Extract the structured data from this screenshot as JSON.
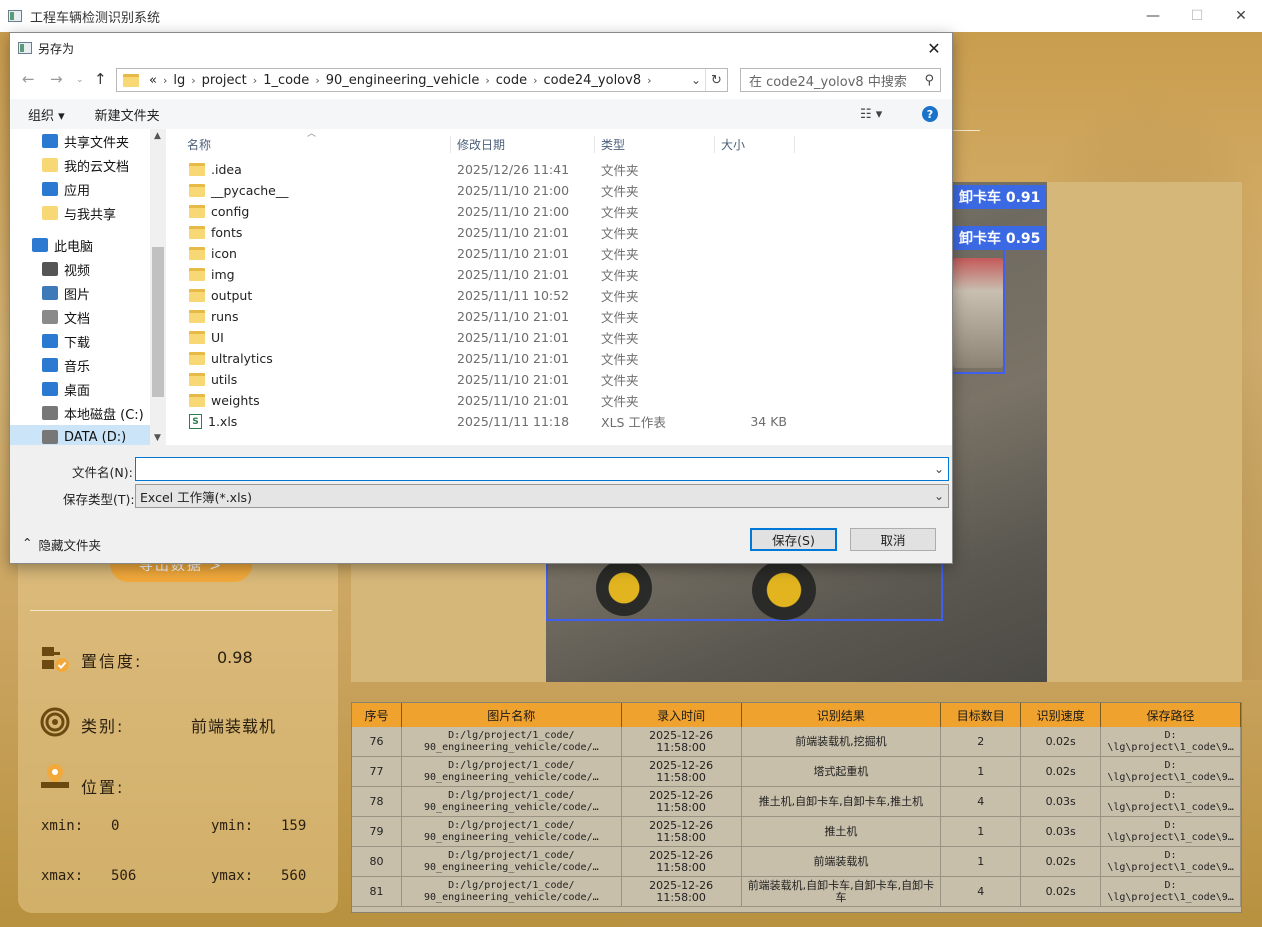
{
  "app": {
    "title": "工程车辆检测识别系统",
    "minimize": "—",
    "maximize": "☐",
    "close": "✕"
  },
  "left_panel": {
    "export_label": "导出数据 >",
    "confidence_label": "置信度:",
    "confidence_value": "0.98",
    "class_label": "类别:",
    "class_value": "前端装载机",
    "position_label": "位置:",
    "xmin_label": "xmin:",
    "xmin_value": "0",
    "ymin_label": "ymin:",
    "ymin_value": "159",
    "xmax_label": "xmax:",
    "xmax_value": "506",
    "ymax_label": "ymax:",
    "ymax_value": "560"
  },
  "detections": {
    "label1": "卸卡车 0.91",
    "label2": "卸卡车 0.95"
  },
  "table": {
    "headers": [
      "序号",
      "图片名称",
      "录入时间",
      "识别结果",
      "目标数目",
      "识别速度",
      "保存路径"
    ],
    "rows": [
      [
        "76",
        "D:/lg/project/1_code/\n90_engineering_vehicle/code/…",
        "2025-12-26\n11:58:00",
        "前端装载机,挖掘机",
        "2",
        "0.02s",
        "D:\n\\lg\\project\\1_code\\9…"
      ],
      [
        "77",
        "D:/lg/project/1_code/\n90_engineering_vehicle/code/…",
        "2025-12-26\n11:58:00",
        "塔式起重机",
        "1",
        "0.02s",
        "D:\n\\lg\\project\\1_code\\9…"
      ],
      [
        "78",
        "D:/lg/project/1_code/\n90_engineering_vehicle/code/…",
        "2025-12-26\n11:58:00",
        "推土机,自卸卡车,自卸卡车,推土机",
        "4",
        "0.03s",
        "D:\n\\lg\\project\\1_code\\9…"
      ],
      [
        "79",
        "D:/lg/project/1_code/\n90_engineering_vehicle/code/…",
        "2025-12-26\n11:58:00",
        "推土机",
        "1",
        "0.03s",
        "D:\n\\lg\\project\\1_code\\9…"
      ],
      [
        "80",
        "D:/lg/project/1_code/\n90_engineering_vehicle/code/…",
        "2025-12-26\n11:58:00",
        "前端装载机",
        "1",
        "0.02s",
        "D:\n\\lg\\project\\1_code\\9…"
      ],
      [
        "81",
        "D:/lg/project/1_code/\n90_engineering_vehicle/code/…",
        "2025-12-26\n11:58:00",
        "前端装载机,自卸卡车,自卸卡车,自卸卡车",
        "4",
        "0.02s",
        "D:\n\\lg\\project\\1_code\\9…"
      ]
    ]
  },
  "dialog": {
    "title": "另存为",
    "breadcrumb": [
      "«",
      "lg",
      "project",
      "1_code",
      "90_engineering_vehicle",
      "code",
      "code24_yolov8"
    ],
    "search_placeholder": "在 code24_yolov8 中搜索",
    "organize": "组织 ▾",
    "new_folder": "新建文件夹",
    "nav_items": [
      {
        "label": "共享文件夹",
        "icon": "share-icon"
      },
      {
        "label": "我的云文档",
        "icon": "folder-icon"
      },
      {
        "label": "应用",
        "icon": "apps-icon"
      },
      {
        "label": "与我共享",
        "icon": "folder-icon"
      },
      {
        "label": "此电脑",
        "icon": "computer-icon"
      },
      {
        "label": "视频",
        "icon": "video-icon"
      },
      {
        "label": "图片",
        "icon": "picture-icon"
      },
      {
        "label": "文档",
        "icon": "document-icon"
      },
      {
        "label": "下载",
        "icon": "download-icon"
      },
      {
        "label": "音乐",
        "icon": "music-icon"
      },
      {
        "label": "桌面",
        "icon": "desktop-icon"
      },
      {
        "label": "本地磁盘 (C:)",
        "icon": "drive-icon"
      },
      {
        "label": "DATA (D:)",
        "icon": "drive-icon"
      }
    ],
    "columns": [
      "名称",
      "修改日期",
      "类型",
      "大小"
    ],
    "files": [
      {
        "name": ".idea",
        "date": "2025/12/26 11:41",
        "type": "文件夹",
        "size": "",
        "kind": "folder"
      },
      {
        "name": "__pycache__",
        "date": "2025/11/10 21:00",
        "type": "文件夹",
        "size": "",
        "kind": "folder"
      },
      {
        "name": "config",
        "date": "2025/11/10 21:00",
        "type": "文件夹",
        "size": "",
        "kind": "folder"
      },
      {
        "name": "fonts",
        "date": "2025/11/10 21:01",
        "type": "文件夹",
        "size": "",
        "kind": "folder"
      },
      {
        "name": "icon",
        "date": "2025/11/10 21:01",
        "type": "文件夹",
        "size": "",
        "kind": "folder"
      },
      {
        "name": "img",
        "date": "2025/11/10 21:01",
        "type": "文件夹",
        "size": "",
        "kind": "folder"
      },
      {
        "name": "output",
        "date": "2025/11/11 10:52",
        "type": "文件夹",
        "size": "",
        "kind": "folder"
      },
      {
        "name": "runs",
        "date": "2025/11/10 21:01",
        "type": "文件夹",
        "size": "",
        "kind": "folder"
      },
      {
        "name": "UI",
        "date": "2025/11/10 21:01",
        "type": "文件夹",
        "size": "",
        "kind": "folder"
      },
      {
        "name": "ultralytics",
        "date": "2025/11/10 21:01",
        "type": "文件夹",
        "size": "",
        "kind": "folder"
      },
      {
        "name": "utils",
        "date": "2025/11/10 21:01",
        "type": "文件夹",
        "size": "",
        "kind": "folder"
      },
      {
        "name": "weights",
        "date": "2025/11/10 21:01",
        "type": "文件夹",
        "size": "",
        "kind": "folder"
      },
      {
        "name": "1.xls",
        "date": "2025/11/11 11:18",
        "type": "XLS 工作表",
        "size": "34 KB",
        "kind": "xls"
      }
    ],
    "filename_label": "文件名(N):",
    "filename_value": "",
    "filetype_label": "保存类型(T):",
    "filetype_value": "Excel 工作簿(*.xls)",
    "hide_folders": "隐藏文件夹",
    "save": "保存(S)",
    "cancel": "取消"
  }
}
